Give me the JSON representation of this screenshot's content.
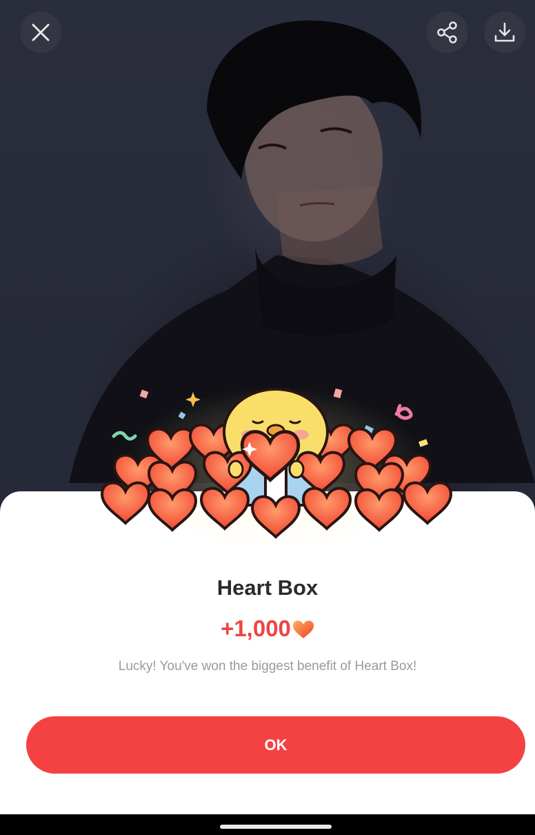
{
  "viewer": {
    "close_icon": "close-icon",
    "share_icon": "share-icon",
    "download_icon": "download-icon"
  },
  "reward_popup": {
    "title": "Heart Box",
    "amount": "+1,000",
    "amount_icon": "heart-icon",
    "message": "Lucky! You've won the biggest benefit of Heart Box!",
    "ok_label": "OK"
  },
  "colors": {
    "accent": "#f44242",
    "reward_text": "#ef4444",
    "heart": "#f05a3a"
  }
}
